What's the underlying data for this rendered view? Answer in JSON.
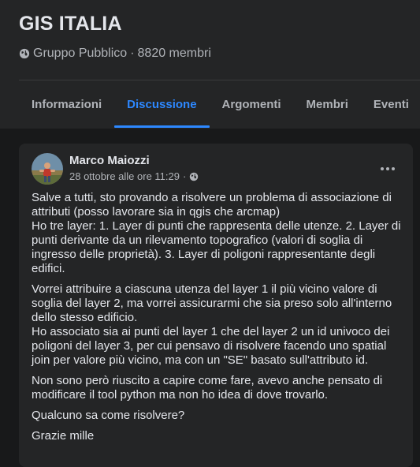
{
  "group": {
    "name": "GIS ITALIA",
    "privacy": "Gruppo Pubblico",
    "separator": "·",
    "members": "8820 membri"
  },
  "tabs": [
    {
      "label": "Informazioni",
      "active": false
    },
    {
      "label": "Discussione",
      "active": true
    },
    {
      "label": "Argomenti",
      "active": false
    },
    {
      "label": "Membri",
      "active": false
    },
    {
      "label": "Eventi",
      "active": false
    }
  ],
  "post": {
    "author": "Marco Maiozzi",
    "timestamp": "28 ottobre alle ore 11:29",
    "separator": "·",
    "privacy_icon": "globe-icon",
    "paragraphs": [
      [
        "Salve a tutti, sto provando a risolvere un problema di associazione di attributi (posso lavorare sia in qgis che arcmap)",
        "Ho tre layer: 1. Layer di punti che rappresenta delle utenze. 2. Layer di punti derivante da un rilevamento topografico (valori di soglia di ingresso delle proprietà). 3. Layer di poligoni rappresentante degli edifici."
      ],
      [
        "Vorrei attribuire a ciascuna utenza del layer 1 il più vicino valore di soglia del layer 2, ma vorrei assicurarmi che sia preso solo all'interno dello stesso edificio.",
        "Ho associato sia ai punti del layer 1 che del layer 2 un id univoco dei poligoni del layer 3, per cui pensavo di risolvere facendo uno spatial join per valore più vicino, ma con un \"SE\" basato sull'attributo id."
      ],
      [
        "Non sono però riuscito a capire come fare, avevo anche pensato di modificare il tool python ma non ho idea di dove trovarlo."
      ],
      [
        "Qualcuno sa come risolvere?"
      ],
      [
        "Grazie mille"
      ]
    ]
  },
  "colors": {
    "background": "#18191a",
    "surface": "#242526",
    "accent": "#2d88ff",
    "text_primary": "#e4e6eb",
    "text_secondary": "#b0b3b8"
  }
}
